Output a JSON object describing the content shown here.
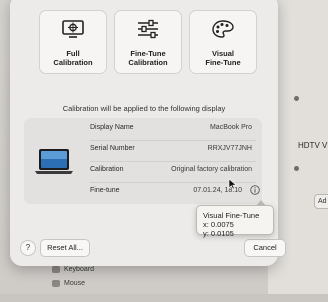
{
  "background": {
    "tv_label": "HDTV V",
    "ad_button": "Ad",
    "sidebar": [
      "Keyboard",
      "Mouse"
    ]
  },
  "modes": [
    {
      "label": "Full\nCalibration",
      "icon": "target-screen-icon"
    },
    {
      "label": "Fine-Tune\nCalibration",
      "icon": "sliders-icon"
    },
    {
      "label": "Visual\nFine-Tune",
      "icon": "palette-icon"
    }
  ],
  "applied_text": "Calibration will be applied to the following display",
  "display_info": {
    "rows": [
      {
        "key": "Display Name",
        "value": "MacBook Pro"
      },
      {
        "key": "Serial Number",
        "value": "RRXJV77JNH"
      },
      {
        "key": "Calibration",
        "value": "Original factory calibration"
      },
      {
        "key": "Fine-tune",
        "value": "07.01.24, 18:10"
      }
    ]
  },
  "tooltip": {
    "line1": "Visual Fine-Tune x: 0.0075",
    "line2": "y: 0.0105"
  },
  "buttons": {
    "help": "?",
    "reset": "Reset All...",
    "cancel": "Cancel"
  }
}
